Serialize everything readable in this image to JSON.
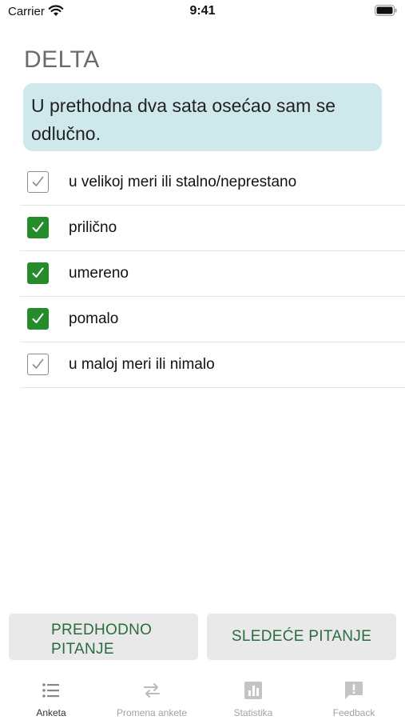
{
  "status_bar": {
    "carrier": "Carrier",
    "time": "9:41"
  },
  "survey": {
    "title": "DELTA",
    "question": "U prethodna dva sata osećao sam se odlučno."
  },
  "options": [
    {
      "label": "u velikoj meri ili stalno/neprestano",
      "checked": false
    },
    {
      "label": "prilično",
      "checked": true
    },
    {
      "label": "umereno",
      "checked": true
    },
    {
      "label": "pomalo",
      "checked": true
    },
    {
      "label": "u maloj meri ili nimalo",
      "checked": false
    }
  ],
  "buttons": {
    "previous_line1": "PREDHODNO",
    "previous_line2": "PITANJE",
    "next": "SLEDEĆE PITANJE"
  },
  "tabs": [
    {
      "label": "Anketa",
      "icon": "list-icon",
      "active": true
    },
    {
      "label": "Promena ankete",
      "icon": "swap-arrows-icon",
      "active": false
    },
    {
      "label": "Statistika",
      "icon": "bar-chart-icon",
      "active": false
    },
    {
      "label": "Feedback",
      "icon": "feedback-icon",
      "active": false
    }
  ],
  "colors": {
    "accent_green": "#258c2b",
    "button_text": "#2b6b40",
    "question_background": "#cfe8ec"
  }
}
